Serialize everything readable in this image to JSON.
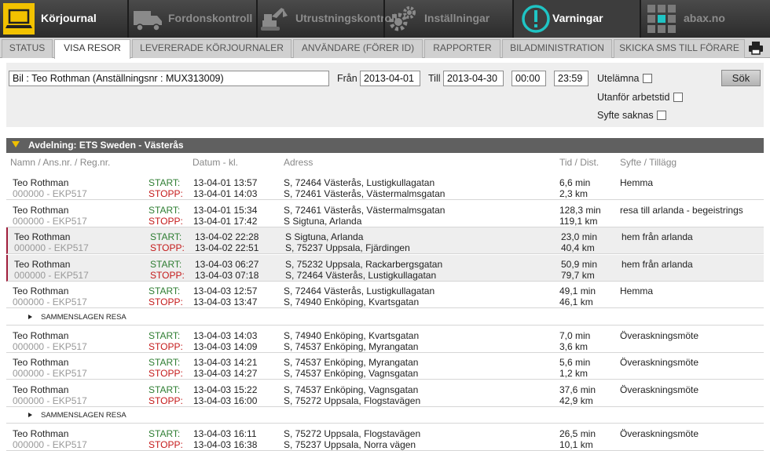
{
  "topnav": {
    "journal": "Körjournal",
    "vehicle": "Fordonskontroll",
    "equipment": "Utrustningskontroll",
    "settings": "Inställningar",
    "warnings": "Varningar",
    "abax": "abax.no"
  },
  "tabs": [
    "STATUS",
    "VISA RESOR",
    "LEVERERADE KÖRJOURNALER",
    "ANVÄNDARE (FÖRER ID)",
    "RAPPORTER",
    "BILADMINISTRATION",
    "SKICKA SMS TILL FÖRARE"
  ],
  "active_tab": "VISA RESOR",
  "filter": {
    "vehicle": "Bil : Teo Rothman (Anställningsnr :  MUX313009)",
    "from_label": "Från",
    "from_date": "2013-04-01",
    "to_label": "Till",
    "to_date": "2013-04-30",
    "time_from": "00:00",
    "time_to": "23:59",
    "search": "Sök",
    "missing": "Utelämna",
    "outside": "Utanför arbetstid",
    "no_purpose": "Syfte saknas"
  },
  "department": "Avdelning: ETS Sweden - Västerås",
  "columns": {
    "name": "Namn / Ans.nr. / Reg.nr.",
    "date": "Datum - kl.",
    "address": "Adress",
    "time": "Tid / Dist.",
    "purpose": "Syfte / Tillägg"
  },
  "labels": {
    "start": "START:",
    "stop": "STOPP:",
    "merged": "SAMMENSLAGEN RESA"
  },
  "rows": [
    {
      "type": "trip",
      "name": "Teo Rothman",
      "id": "000000 - EKP517",
      "start_date": "13-04-01 13:57",
      "stop_date": "13-04-01 14:03",
      "start_addr": "S, 72464 Västerås, Lustigkullagatan",
      "stop_addr": "S, 72461 Västerås, Västermalmsgatan",
      "time": "6,6 min",
      "dist": "2,3 km",
      "purpose": "Hemma",
      "hl": false
    },
    {
      "type": "trip",
      "name": "Teo Rothman",
      "id": "000000 - EKP517",
      "start_date": "13-04-01 15:34",
      "stop_date": "13-04-01 17:42",
      "start_addr": "S, 72461 Västerås, Västermalmsgatan",
      "stop_addr": "S Sigtuna, Arlanda",
      "time": "128,3 min",
      "dist": "119,1 km",
      "purpose": "resa till arlanda - begeistrings",
      "hl": false
    },
    {
      "type": "trip",
      "name": "Teo Rothman",
      "id": "000000 - EKP517",
      "start_date": "13-04-02 22:28",
      "stop_date": "13-04-02 22:51",
      "start_addr": "S Sigtuna, Arlanda",
      "stop_addr": "S, 75237 Uppsala, Fjärdingen",
      "time": "23,0 min",
      "dist": "40,4 km",
      "purpose": "hem från arlanda",
      "hl": true
    },
    {
      "type": "trip",
      "name": "Teo Rothman",
      "id": "000000 - EKP517",
      "start_date": "13-04-03 06:27",
      "stop_date": "13-04-03 07:18",
      "start_addr": "S, 75232 Uppsala, Rackarbergsgatan",
      "stop_addr": "S, 72464 Västerås, Lustigkullagatan",
      "time": "50,9 min",
      "dist": "79,7 km",
      "purpose": "hem från arlanda",
      "hl": true
    },
    {
      "type": "trip",
      "name": "Teo Rothman",
      "id": "000000 - EKP517",
      "start_date": "13-04-03 12:57",
      "stop_date": "13-04-03 13:47",
      "start_addr": "S, 72464 Västerås, Lustigkullagatan",
      "stop_addr": "S, 74940 Enköping, Kvartsgatan",
      "time": "49,1 min",
      "dist": "46,1 km",
      "purpose": "Hemma",
      "hl": false
    },
    {
      "type": "merged"
    },
    {
      "type": "trip",
      "name": "Teo Rothman",
      "id": "000000 - EKP517",
      "start_date": "13-04-03 14:03",
      "stop_date": "13-04-03 14:09",
      "start_addr": "S, 74940 Enköping, Kvartsgatan",
      "stop_addr": "S, 74537 Enköping, Myrangatan",
      "time": "7,0 min",
      "dist": "3,6 km",
      "purpose": "Överaskningsmöte",
      "hl": false
    },
    {
      "type": "trip",
      "name": "Teo Rothman",
      "id": "000000 - EKP517",
      "start_date": "13-04-03 14:21",
      "stop_date": "13-04-03 14:27",
      "start_addr": "S, 74537 Enköping, Myrangatan",
      "stop_addr": "S, 74537 Enköping, Vagnsgatan",
      "time": "5,6 min",
      "dist": "1,2 km",
      "purpose": "Överaskningsmöte",
      "hl": false
    },
    {
      "type": "trip",
      "name": "Teo Rothman",
      "id": "000000 - EKP517",
      "start_date": "13-04-03 15:22",
      "stop_date": "13-04-03 16:00",
      "start_addr": "S, 74537 Enköping, Vagnsgatan",
      "stop_addr": "S, 75272 Uppsala, Flogstavägen",
      "time": "37,6 min",
      "dist": "42,9 km",
      "purpose": "Överaskningsmöte",
      "hl": false
    },
    {
      "type": "merged"
    },
    {
      "type": "trip",
      "name": "Teo Rothman",
      "id": "000000 - EKP517",
      "start_date": "13-04-03 16:11",
      "stop_date": "13-04-03 16:38",
      "start_addr": "S, 75272 Uppsala, Flogstavägen",
      "stop_addr": "S, 75237 Uppsala, Norra vägen",
      "time": "26,5 min",
      "dist": "10,1 km",
      "purpose": "Överaskningsmöte",
      "hl": false
    }
  ]
}
